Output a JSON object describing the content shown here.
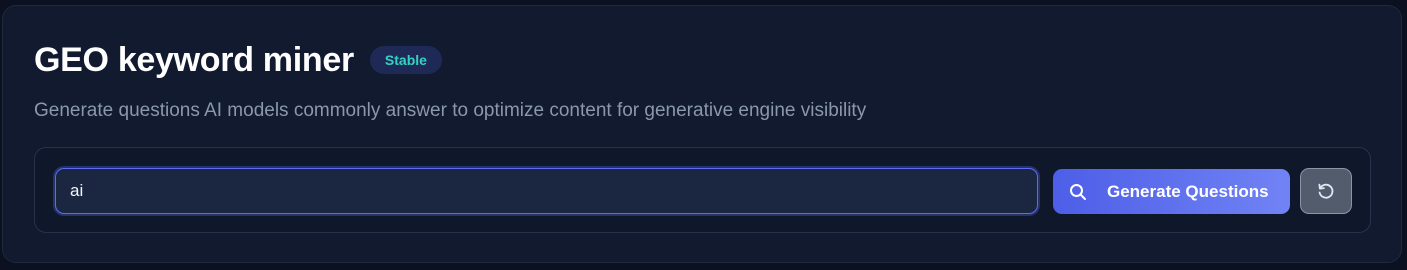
{
  "header": {
    "title": "GEO keyword miner",
    "badge": "Stable",
    "subtitle": "Generate questions AI models commonly answer to optimize content for generative engine visibility"
  },
  "search": {
    "value": "ai",
    "placeholder": "",
    "generate_label": "Generate Questions",
    "generate_icon": "search-icon",
    "reset_icon": "reset-icon"
  },
  "colors": {
    "background": "#0b1120",
    "card": "#111a2f",
    "badge_text": "#34d2c3",
    "accent_start": "#4d5ee8",
    "accent_end": "#7183f4",
    "reset_button": "#535c6d"
  }
}
